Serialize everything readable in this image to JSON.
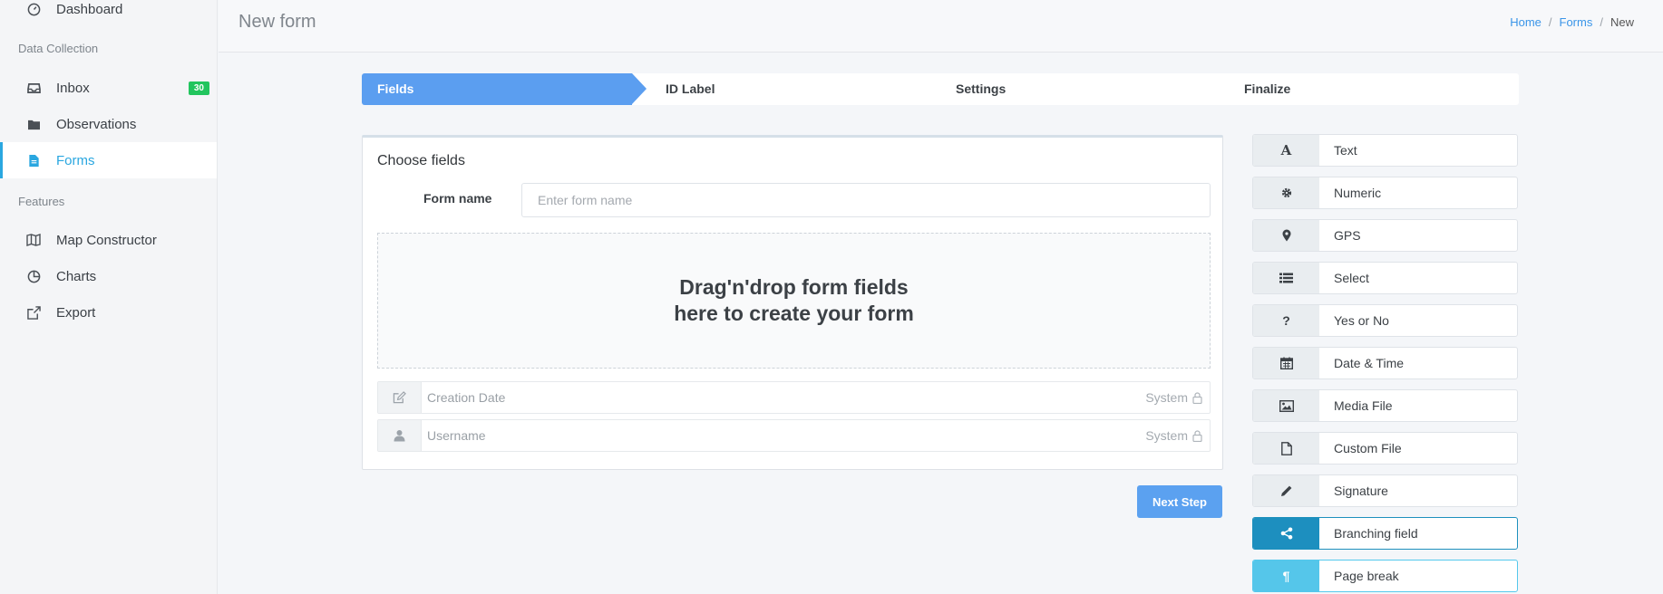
{
  "sidebar": {
    "dashboard": "Dashboard",
    "section_data": "Data Collection",
    "inbox": "Inbox",
    "inbox_badge": "30",
    "observations": "Observations",
    "forms": "Forms",
    "section_features": "Features",
    "map_constructor": "Map Constructor",
    "charts": "Charts",
    "export": "Export"
  },
  "header": {
    "title": "New form",
    "breadcrumb": {
      "home": "Home",
      "forms": "Forms",
      "current": "New"
    }
  },
  "steps": [
    "Fields",
    "ID Label",
    "Settings",
    "Finalize"
  ],
  "card": {
    "title": "Choose fields",
    "form_name_label": "Form name",
    "form_name_placeholder": "Enter form name",
    "dropzone_line1": "Drag'n'drop form fields",
    "dropzone_line2": "here to create your form",
    "system_fields": [
      {
        "name": "Creation Date",
        "tag": "System",
        "icon": "edit-icon"
      },
      {
        "name": "Username",
        "tag": "System",
        "icon": "user-icon"
      }
    ]
  },
  "next_button": "Next Step",
  "palette": [
    {
      "label": "Text",
      "icon": "text-icon"
    },
    {
      "label": "Numeric",
      "icon": "gear-icon"
    },
    {
      "label": "GPS",
      "icon": "map-marker-icon"
    },
    {
      "label": "Select",
      "icon": "list-icon"
    },
    {
      "label": "Yes or No",
      "icon": "question-icon"
    },
    {
      "label": "Date & Time",
      "icon": "calendar-icon"
    },
    {
      "label": "Media File",
      "icon": "image-icon"
    },
    {
      "label": "Custom File",
      "icon": "file-icon"
    },
    {
      "label": "Signature",
      "icon": "pencil-icon"
    },
    {
      "label": "Branching field",
      "icon": "share-icon"
    },
    {
      "label": "Page break",
      "icon": "paragraph-icon"
    }
  ],
  "colors": {
    "accent": "#2aa7e0",
    "step_active": "#5b9ef0",
    "badge": "#22c55e",
    "branch": "#1d8fbf",
    "page_break": "#55c6ea"
  }
}
